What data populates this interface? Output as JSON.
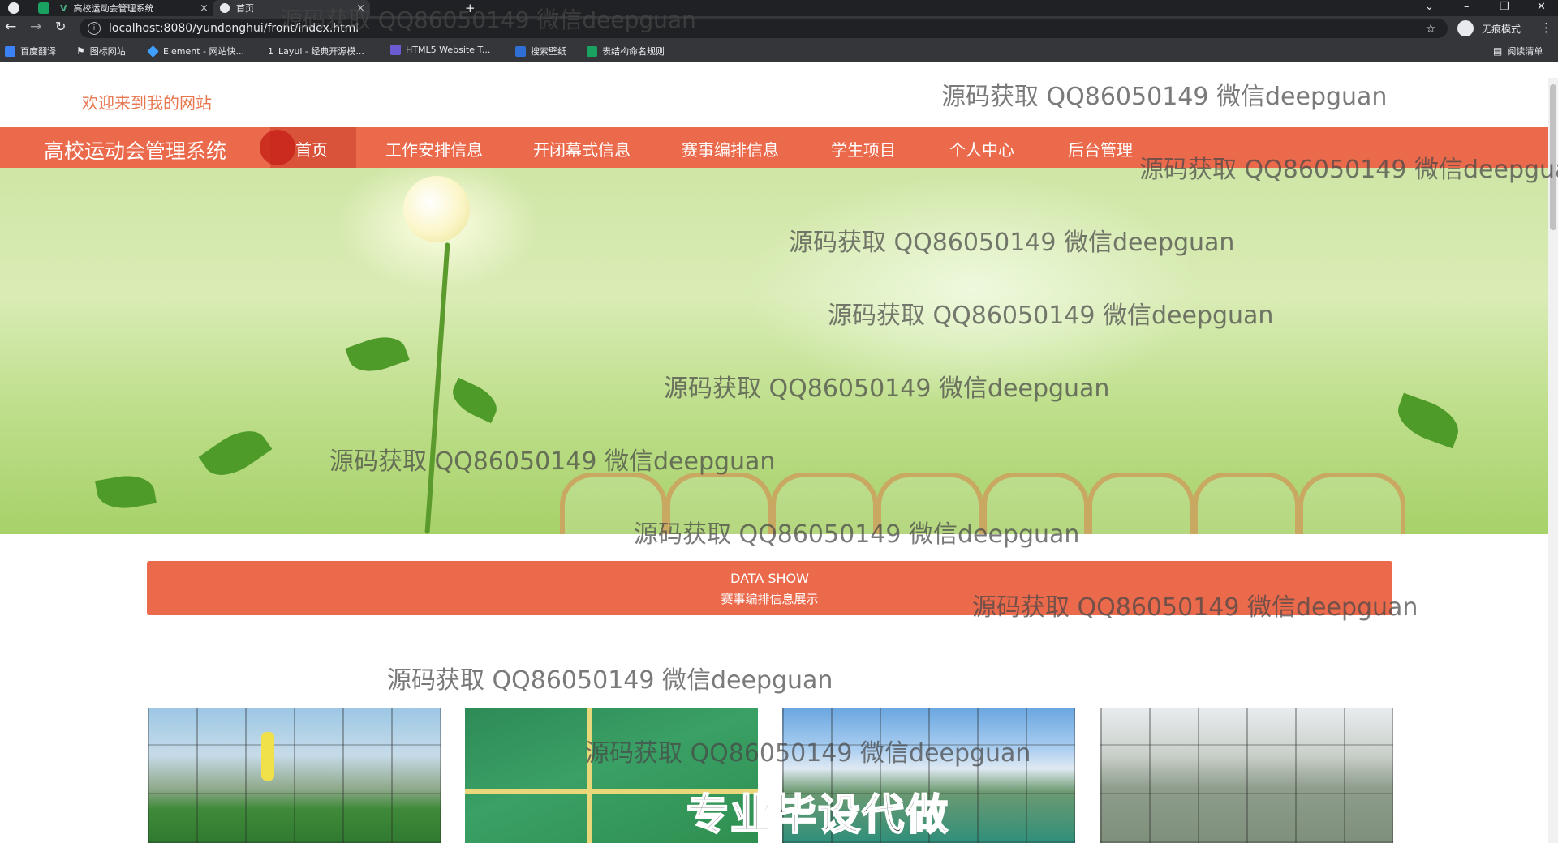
{
  "browser": {
    "tabs": [
      {
        "title": "高校运动会管理系统",
        "active": false
      },
      {
        "title": "首页",
        "active": true
      }
    ],
    "new_tab": "+",
    "tab_close": "×",
    "url": "localhost:8080/yundonghui/front/index.html",
    "incognito_label": "无痕模式",
    "reading_list": "阅读清单",
    "bookmarks": [
      {
        "label": "百度翻译",
        "color": "#3b82f6"
      },
      {
        "label": "图标网站",
        "color": "#e8eaed"
      },
      {
        "label": "Element - 网站快...",
        "color": "#409eff"
      },
      {
        "label": "Layui - 经典开源模...",
        "color": "#e8eaed"
      },
      {
        "label": "HTML5 Website T...",
        "color": "#6b5bd2"
      },
      {
        "label": "搜索壁纸",
        "color": "#2f6fd6"
      },
      {
        "label": "表结构命名规则",
        "color": "#1aa260"
      }
    ]
  },
  "header": {
    "welcome": "欢迎来到我的网站"
  },
  "nav": {
    "brand": "高校运动会管理系统",
    "items": [
      "首页",
      "工作安排信息",
      "开闭幕式信息",
      "赛事编排信息",
      "学生项目",
      "个人中心",
      "后台管理"
    ],
    "active_index": 0
  },
  "colors": {
    "accent": "#ec6a4c",
    "welcome_text": "#e8774f"
  },
  "section": {
    "title_en": "DATA SHOW",
    "title_zh": "赛事编排信息展示"
  },
  "carousel": {
    "slides": 3,
    "active_index": 0
  },
  "watermark": "源码获取 QQ86050149 微信deepguan",
  "promo": "专业毕设代做"
}
